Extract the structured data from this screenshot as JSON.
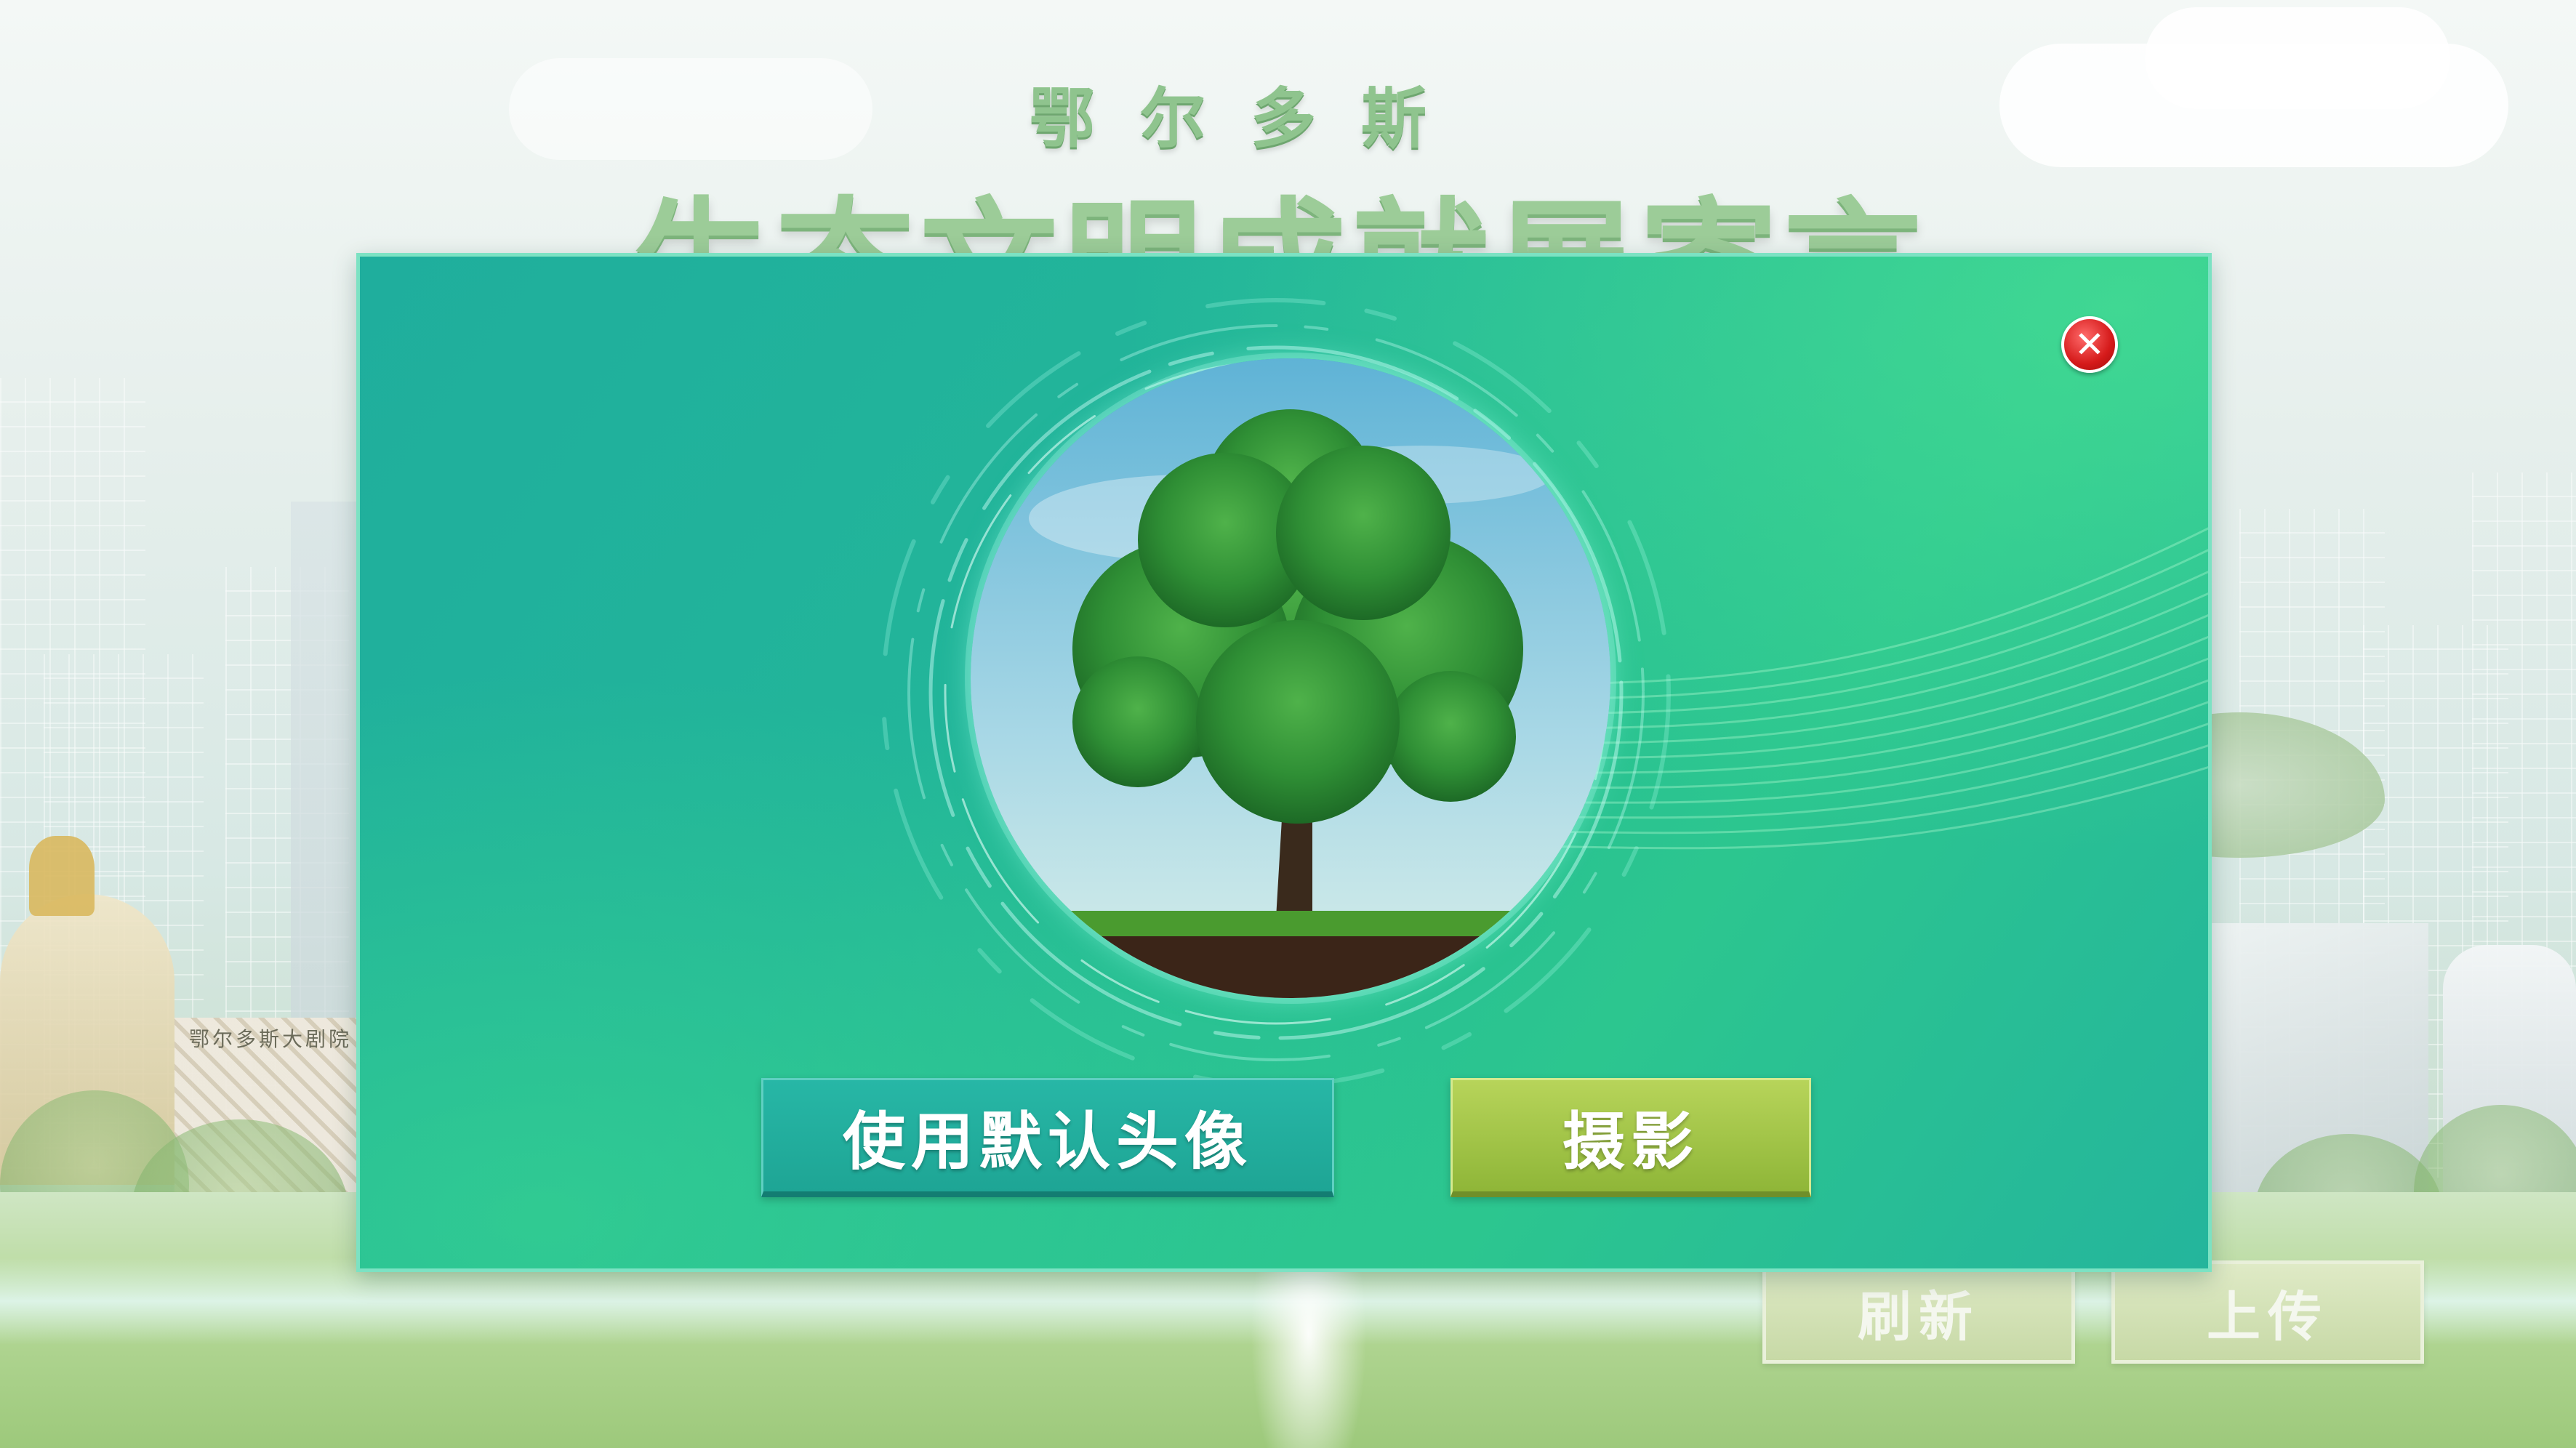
{
  "header": {
    "subtitle": "鄂尔多斯",
    "title": "生态文明成就展寄言"
  },
  "scene": {
    "theater_sign": "鄂尔多斯大剧院"
  },
  "actions": {
    "refresh_label": "刷新",
    "upload_label": "上传"
  },
  "dialog": {
    "close_icon": "close-icon",
    "default_avatar_label": "使用默认头像",
    "photo_label": "摄影",
    "avatar_preview": "tree"
  },
  "colors": {
    "modal_bg": "#22b59a",
    "close_red": "#d51a1a",
    "default_button": "#1ea595",
    "photo_button": "#8fb638"
  }
}
